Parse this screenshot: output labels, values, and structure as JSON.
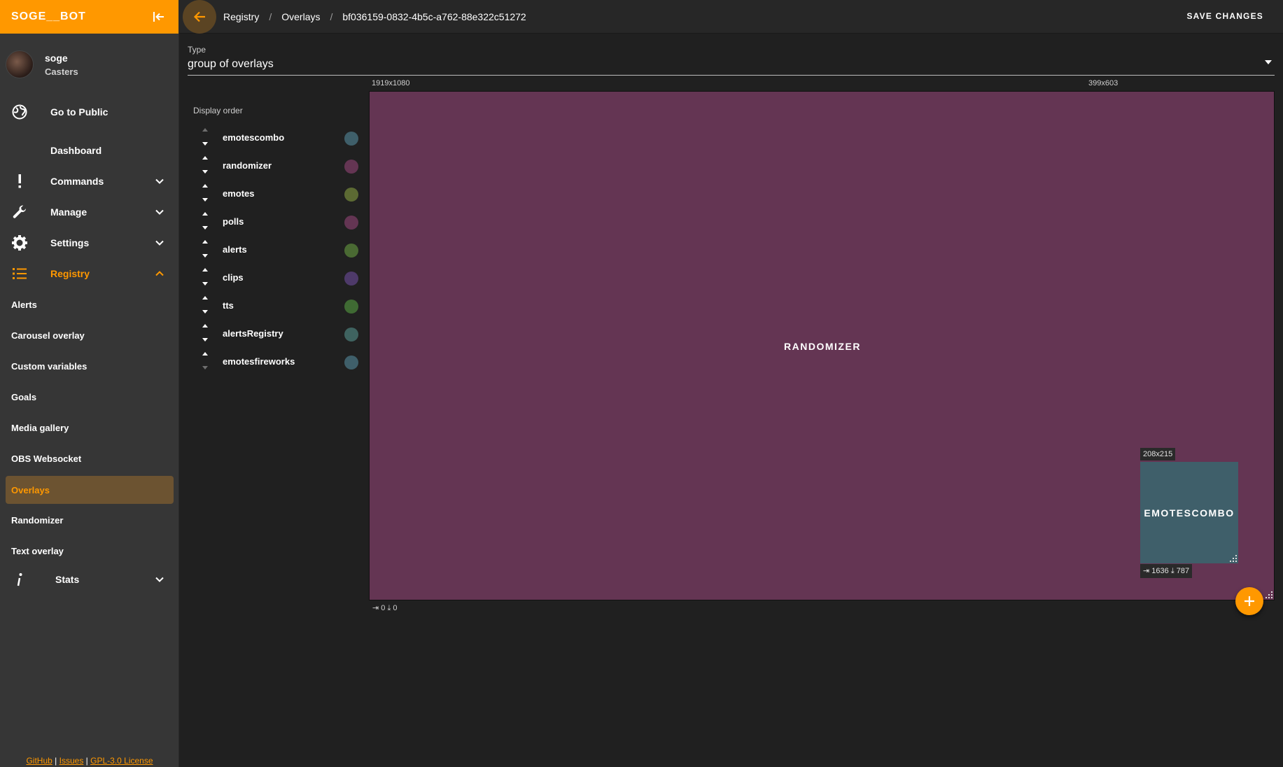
{
  "app": {
    "title": "SOGE__BOT"
  },
  "user": {
    "name": "soge",
    "role": "Casters"
  },
  "nav": {
    "go_public": "Go to Public",
    "dashboard": "Dashboard",
    "commands": "Commands",
    "manage": "Manage",
    "settings": "Settings",
    "registry": "Registry",
    "registry_items": [
      "Alerts",
      "Carousel overlay",
      "Custom variables",
      "Goals",
      "Media gallery",
      "OBS Websocket",
      "Overlays",
      "Randomizer",
      "Text overlay"
    ],
    "active_item": "Overlays",
    "stats": "Stats"
  },
  "footer": {
    "github": "GitHub",
    "sep": "|",
    "issues": "Issues",
    "license": "GPL-3.0 License"
  },
  "breadcrumb": [
    "Registry",
    "Overlays",
    "bf036159-0832-4b5c-a762-88e322c51272"
  ],
  "toolbar": {
    "save_label": "SAVE CHANGES"
  },
  "type_field": {
    "label": "Type",
    "value": "group of overlays"
  },
  "display_order": {
    "title": "Display order",
    "items": [
      {
        "name": "emotescombo",
        "color": "#3f5f6a"
      },
      {
        "name": "randomizer",
        "color": "#643553"
      },
      {
        "name": "emotes",
        "color": "#5c6a33"
      },
      {
        "name": "polls",
        "color": "#643553"
      },
      {
        "name": "alerts",
        "color": "#4a6a33"
      },
      {
        "name": "clips",
        "color": "#4e3a6a"
      },
      {
        "name": "tts",
        "color": "#3f6a33"
      },
      {
        "name": "alertsRegistry",
        "color": "#3f6360"
      },
      {
        "name": "emotesfireworks",
        "color": "#3f5f6a"
      }
    ]
  },
  "canvas": {
    "size_label": "1919x1080",
    "secondary_size_label": "399x603",
    "overlay_label": "RANDOMIZER",
    "background": "#643553",
    "pos_x": "0",
    "pos_y": "0"
  },
  "selected_overlay": {
    "label": "EMOTESCOMBO",
    "size_label": "208x215",
    "pos_x": "1636",
    "pos_y": "787",
    "background": "#3f5f6a"
  },
  "colors": {
    "accent": "#ff9800"
  }
}
